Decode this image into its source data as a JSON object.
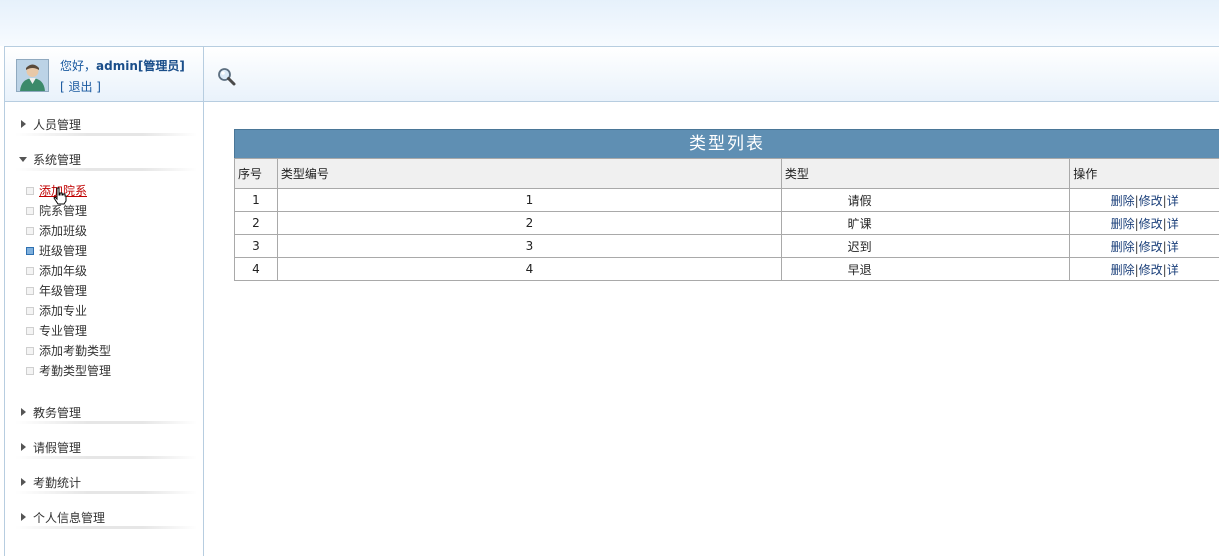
{
  "header": {
    "greeting": "您好，",
    "username": "admin[管理员]",
    "logout": "[ 退出 ]"
  },
  "sidebar": {
    "groups": [
      {
        "label": "人员管理",
        "expanded": false
      },
      {
        "label": "系统管理",
        "expanded": true,
        "items": [
          {
            "label": "添加院系"
          },
          {
            "label": "院系管理"
          },
          {
            "label": "添加班级"
          },
          {
            "label": "班级管理"
          },
          {
            "label": "添加年级"
          },
          {
            "label": "年级管理"
          },
          {
            "label": "添加专业"
          },
          {
            "label": "专业管理"
          },
          {
            "label": "添加考勤类型"
          },
          {
            "label": "考勤类型管理"
          }
        ]
      },
      {
        "label": "教务管理",
        "expanded": false
      },
      {
        "label": "请假管理",
        "expanded": false
      },
      {
        "label": "考勤统计",
        "expanded": false
      },
      {
        "label": "个人信息管理",
        "expanded": false
      }
    ]
  },
  "table": {
    "title": "类型列表",
    "headers": [
      "序号",
      "类型编号",
      "类型",
      "操作"
    ],
    "rows": [
      {
        "index": "1",
        "code": "1",
        "type": "请假"
      },
      {
        "index": "2",
        "code": "2",
        "type": "旷课"
      },
      {
        "index": "3",
        "code": "3",
        "type": "迟到"
      },
      {
        "index": "4",
        "code": "4",
        "type": "早退"
      }
    ],
    "actions": {
      "delete": "删除",
      "edit": "修改",
      "detail": "详",
      "sep": "|"
    }
  },
  "icons": {
    "search": "magnifier-icon",
    "avatar": "user-avatar-icon"
  },
  "colors": {
    "caption_bg": "#5f8fb3",
    "link": "#1a5aa0",
    "hover_link": "#c00000"
  }
}
